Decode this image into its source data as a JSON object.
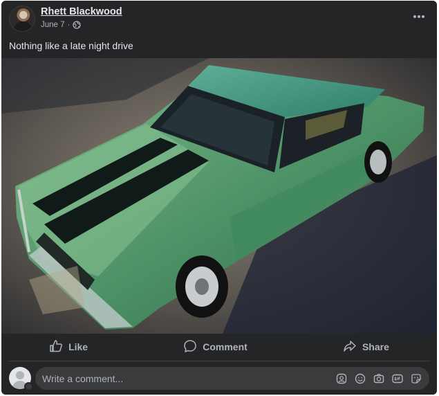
{
  "post": {
    "author": "Rhett Blackwood",
    "date": "June 7",
    "separator": "·",
    "audience_icon": "globe-icon",
    "caption": "Nothing like a late night drive",
    "more_icon": "more-options-icon"
  },
  "actions": {
    "like": "Like",
    "comment": "Comment",
    "share": "Share"
  },
  "composer": {
    "placeholder": "Write a comment...",
    "tools": [
      "avatar-sticker-icon",
      "emoji-icon",
      "camera-icon",
      "gif-icon",
      "sticker-icon"
    ]
  },
  "colors": {
    "card": "#242526",
    "input": "#3a3b3c",
    "text": "#e4e6eb",
    "muted": "#b0b3b8"
  }
}
